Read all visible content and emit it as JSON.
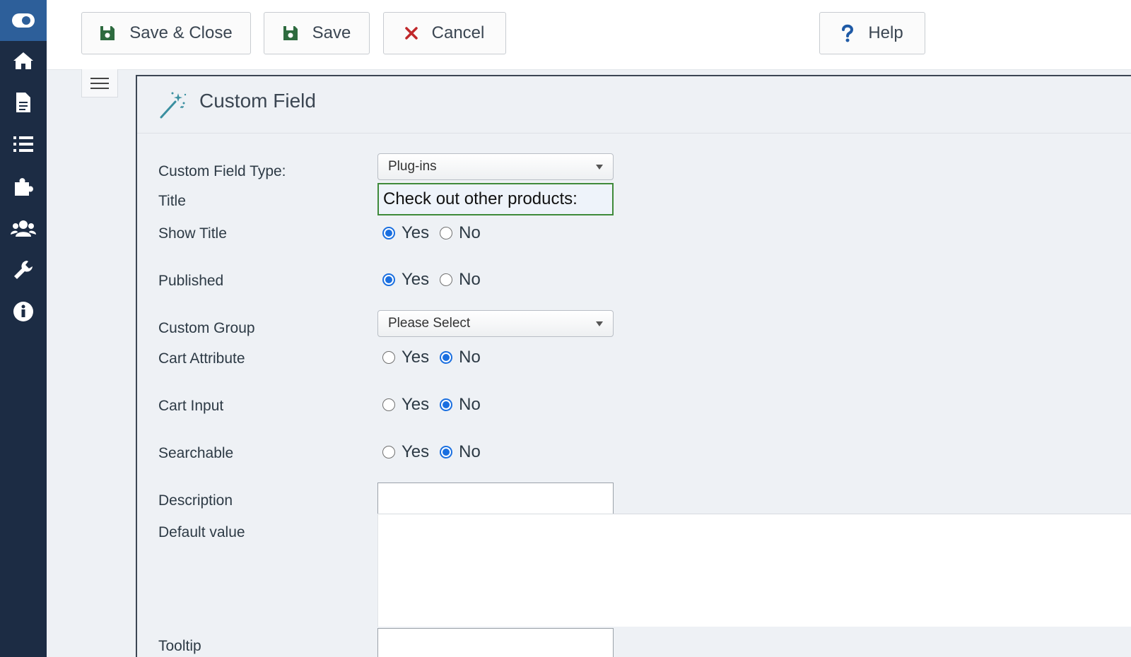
{
  "toolbar": {
    "save_close_label": "Save & Close",
    "save_label": "Save",
    "cancel_label": "Cancel",
    "help_label": "Help"
  },
  "sidebar": {
    "items": [
      {
        "icon": "toggle-icon"
      },
      {
        "icon": "home-icon"
      },
      {
        "icon": "document-icon"
      },
      {
        "icon": "list-icon"
      },
      {
        "icon": "puzzle-icon"
      },
      {
        "icon": "users-icon"
      },
      {
        "icon": "wrench-icon"
      },
      {
        "icon": "info-icon"
      }
    ]
  },
  "panel": {
    "title": "Custom Field"
  },
  "form": {
    "custom_field_type": {
      "label": "Custom Field Type:",
      "value": "Plug-ins"
    },
    "title": {
      "label": "Title",
      "value": "Check out other products:"
    },
    "show_title": {
      "label": "Show Title",
      "yes": "Yes",
      "no": "No",
      "selected": "Yes"
    },
    "published": {
      "label": "Published",
      "yes": "Yes",
      "no": "No",
      "selected": "Yes"
    },
    "custom_group": {
      "label": "Custom Group",
      "value": "Please Select"
    },
    "cart_attribute": {
      "label": "Cart Attribute",
      "yes": "Yes",
      "no": "No",
      "selected": "No"
    },
    "cart_input": {
      "label": "Cart Input",
      "yes": "Yes",
      "no": "No",
      "selected": "No"
    },
    "searchable": {
      "label": "Searchable",
      "yes": "Yes",
      "no": "No",
      "selected": "No"
    },
    "description": {
      "label": "Description",
      "value": ""
    },
    "default_value": {
      "label": "Default value",
      "value": ""
    },
    "tooltip": {
      "label": "Tooltip",
      "value": ""
    }
  },
  "colors": {
    "sidebar_bg": "#1c2c44",
    "sidebar_active": "#2d5f9a",
    "save_icon": "#2e6b3f",
    "cancel_icon": "#c0282b",
    "help_icon": "#1f5aa6",
    "radio_selected": "#1a6fe0",
    "title_border": "#3f8a3a"
  }
}
